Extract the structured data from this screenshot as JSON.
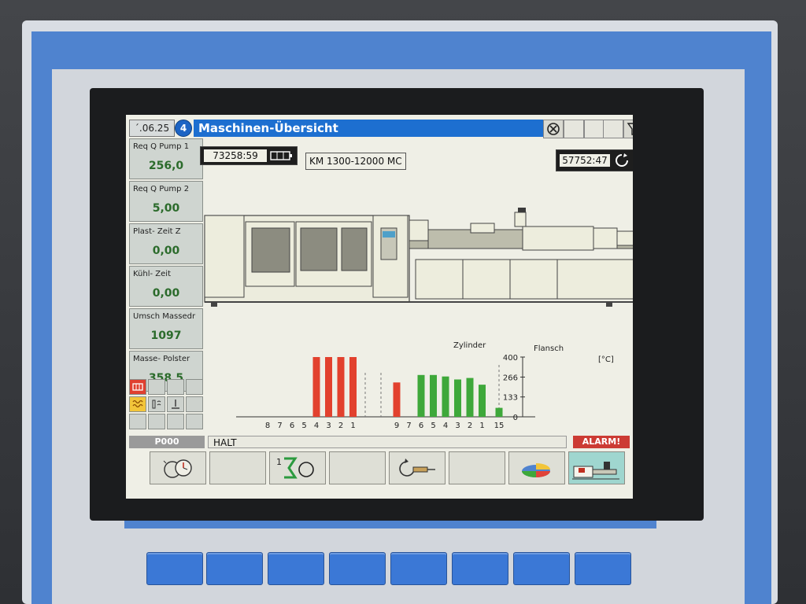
{
  "topbar": {
    "date": "´.06.25",
    "page_number": "4",
    "title": "Maschinen-Übersicht"
  },
  "params": [
    {
      "label": "Req Q Pump 1",
      "value": "256,0"
    },
    {
      "label": "Req Q Pump 2",
      "value": "5,00"
    },
    {
      "label": "Plast- Zeit Z",
      "value": "0,00"
    },
    {
      "label": "Kühl- Zeit",
      "value": "0,00"
    },
    {
      "label": "Umsch Massedr",
      "value": "1097"
    },
    {
      "label": "Masse- Polster",
      "value": "358,5"
    }
  ],
  "counters": {
    "hours": "73258:59",
    "cycles": "57752:47"
  },
  "machine_model": "KM 1300-12000 MC",
  "status": {
    "program": "P000",
    "state": "HALT",
    "alarm": "ALARM!"
  },
  "icons": {
    "title_buttons": [
      "stop-circle-icon",
      "blank",
      "blank",
      "blank",
      "funnel-icon",
      "chart-icon"
    ],
    "fkeys": [
      "clock-gauge-icon",
      "blank",
      "sum-cycle-icon",
      "blank",
      "cycle-screw-icon",
      "blank",
      "pie-chart-icon",
      "machine-icon"
    ]
  },
  "chart_data": {
    "type": "bar",
    "groups": [
      {
        "name": "",
        "categories": [
          "8",
          "7",
          "6",
          "5",
          "4",
          "3",
          "2",
          "1"
        ],
        "values": [
          null,
          null,
          null,
          null,
          400,
          400,
          400,
          400
        ],
        "color": "#e2412e"
      },
      {
        "name": "Zylinder",
        "categories": [
          "9",
          "7",
          "6",
          "5",
          "4",
          "3",
          "2",
          "1"
        ],
        "values": [
          230,
          null,
          280,
          280,
          270,
          250,
          260,
          215
        ],
        "colors": [
          "#e2412e",
          "#3ea83a",
          "#3ea83a",
          "#3ea83a",
          "#3ea83a",
          "#3ea83a",
          "#3ea83a",
          "#3ea83a"
        ]
      },
      {
        "name": "Flansch",
        "categories": [
          "15"
        ],
        "values": [
          60
        ],
        "color": "#3ea83a"
      }
    ],
    "x_extra_labels": [
      "8",
      "7",
      "6",
      "5",
      "4",
      "3",
      "2",
      "1",
      "9",
      "7",
      "6",
      "5",
      "4",
      "3",
      "2",
      "1",
      "15"
    ],
    "yticks": [
      "400",
      "266",
      "133",
      "0"
    ],
    "yunit": "[°C]",
    "ylim": [
      0,
      400
    ]
  }
}
